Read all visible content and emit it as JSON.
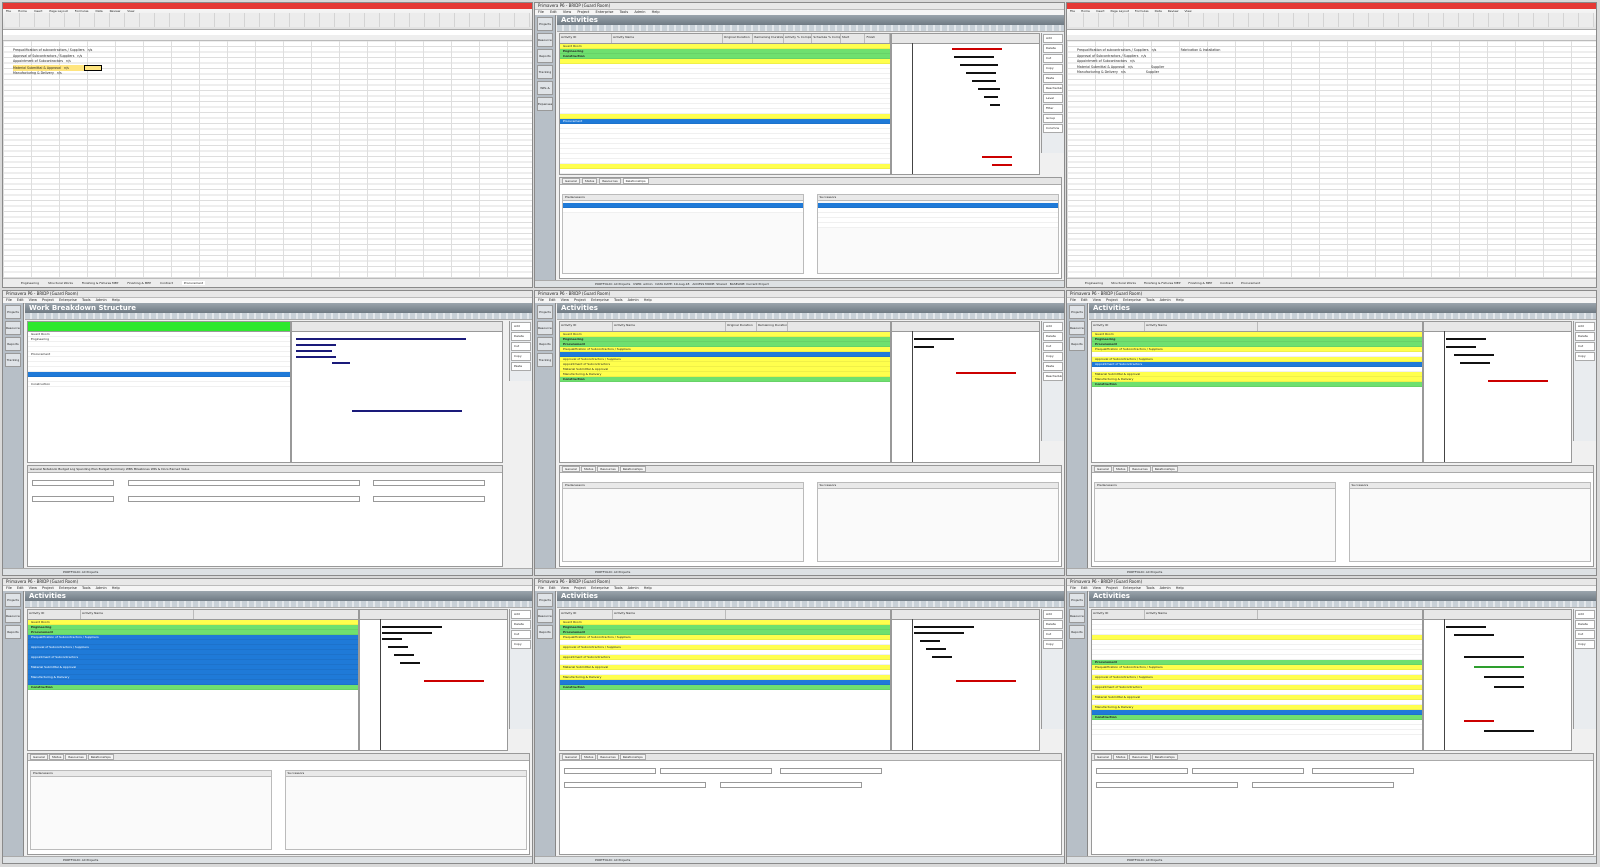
{
  "excel": {
    "ribbon_tabs": [
      "File",
      "Home",
      "Insert",
      "Page Layout",
      "Formulas",
      "Data",
      "Review",
      "View"
    ],
    "rows": [
      "Prequalification of subcontractors / Suppliers",
      "Approval of Subcontractors / Suppliers",
      "Appointment of Subcontractors",
      "Material Submittal & Approval",
      "Manufacturing & Delivery"
    ],
    "col_b": [
      "n/s",
      "n/s",
      "n/s",
      "n/s",
      "n/s"
    ],
    "right_col_c": [
      "Fabrication & Installation",
      "",
      "",
      "Supplier",
      "Supplier"
    ],
    "sheet_tabs": [
      "Engineering",
      "Structural Works",
      "Finishing & Fixtures MEP",
      "Finishing & MEP",
      "Contract",
      "Procurement"
    ]
  },
  "p6": {
    "app_title": "Primavera P6 - BRIDP (Guard Room)",
    "menus": [
      "File",
      "Edit",
      "View",
      "Project",
      "Enterprise",
      "Tools",
      "Admin",
      "Help"
    ],
    "activities_title": "Activities",
    "wbs_title": "Work Breakdown Structure",
    "project_name": "Guard Room",
    "wbs_groups": [
      "Engineering",
      "Procurement",
      "Construction"
    ],
    "proc_subs": [
      "Prequalification of Subcontractors / Suppliers",
      "Approval of Subcontractors / Suppliers",
      "Appointment of Subcontractors",
      "Material Submittal & Approval",
      "Manufacturing & Delivery"
    ],
    "columns": [
      "Activity ID",
      "Activity Name",
      "Original Duration",
      "Remaining Duration",
      "Activity % Complete",
      "Schedule % Complete",
      "Start",
      "Finish",
      "Total Float"
    ],
    "left_nav": [
      "Projects",
      "Resources",
      "Reports",
      "Tracking",
      "WPs & Docs",
      "Expenses",
      "Thresholds",
      "Issues",
      "Risks"
    ],
    "right_nav": [
      "Add",
      "Delete",
      "Cut",
      "Copy",
      "Paste",
      "Remove",
      "Reschedule",
      "Level",
      "Filter",
      "Group",
      "Columns",
      "Bars"
    ],
    "detail_tabs": [
      "General",
      "Status",
      "Resources",
      "Relationships"
    ],
    "predecessors": "Predecessors",
    "successors": "Successors",
    "status_items": [
      "PORTFOLIO: All Projects",
      "USER: admin",
      "DATA DATE: 19-Aug-18",
      "ACCESS MODE: Shared",
      "BASELINE: Current Project"
    ],
    "wbs_rows": [
      "Guard Room",
      "Engineering",
      "Procurement",
      "Construction"
    ],
    "wbs_detail_tabs": [
      "General",
      "Notebook",
      "Budget Log",
      "Spending Plan",
      "Budget Summary",
      "WBS Milestones",
      "WPs & Docs",
      "Earned Value"
    ]
  }
}
